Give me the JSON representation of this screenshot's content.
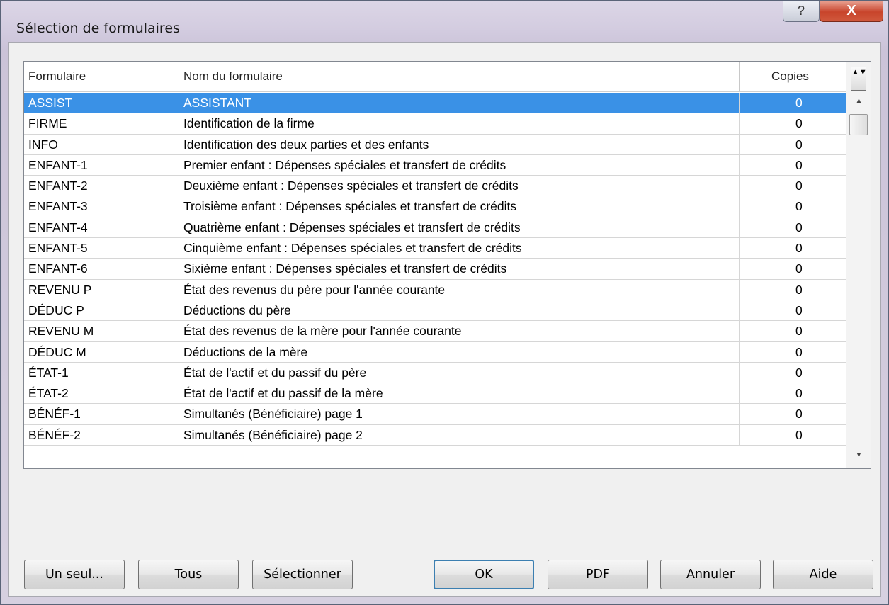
{
  "window": {
    "title": "Sélection de formulaires"
  },
  "titlebar": {
    "help_glyph": "?",
    "close_glyph": "X"
  },
  "grid": {
    "columns": [
      "Formulaire",
      "Nom du formulaire",
      "Copies"
    ],
    "sort_glyph": "▲▼",
    "scroll_up_glyph": "▲",
    "scroll_down_glyph": "▼",
    "rows": [
      {
        "code": "ASSIST",
        "name": "ASSISTANT",
        "copies": "0",
        "selected": true
      },
      {
        "code": "FIRME",
        "name": "Identification de la firme",
        "copies": "0"
      },
      {
        "code": "INFO",
        "name": "Identification des deux parties et des enfants",
        "copies": "0"
      },
      {
        "code": "ENFANT-1",
        "name": "Premier enfant : Dépenses spéciales et transfert de crédits",
        "copies": "0"
      },
      {
        "code": "ENFANT-2",
        "name": "Deuxième enfant : Dépenses spéciales et transfert de crédits",
        "copies": "0"
      },
      {
        "code": "ENFANT-3",
        "name": "Troisième enfant : Dépenses spéciales et transfert de crédits",
        "copies": "0"
      },
      {
        "code": "ENFANT-4",
        "name": "Quatrième enfant : Dépenses spéciales et transfert de crédits",
        "copies": "0"
      },
      {
        "code": "ENFANT-5",
        "name": "Cinquième enfant : Dépenses spéciales et transfert de crédits",
        "copies": "0"
      },
      {
        "code": "ENFANT-6",
        "name": "Sixième enfant : Dépenses spéciales et transfert de crédits",
        "copies": "0"
      },
      {
        "code": "REVENU P",
        "name": "État des revenus du père pour l'année courante",
        "copies": "0"
      },
      {
        "code": "DÉDUC P",
        "name": "Déductions du père",
        "copies": "0"
      },
      {
        "code": "REVENU M",
        "name": "État des revenus de la mère pour l'année courante",
        "copies": "0"
      },
      {
        "code": "DÉDUC M",
        "name": "Déductions de la mère",
        "copies": "0"
      },
      {
        "code": "ÉTAT-1",
        "name": "État de l'actif et du passif du père",
        "copies": "0"
      },
      {
        "code": "ÉTAT-2",
        "name": "État de l'actif et du passif de la mère",
        "copies": "0"
      },
      {
        "code": "BÉNÉF-1",
        "name": "Simultanés (Bénéficiaire) page 1",
        "copies": "0"
      },
      {
        "code": "BÉNÉF-2",
        "name": "Simultanés (Bénéficiaire) page 2",
        "copies": "0"
      }
    ]
  },
  "buttons": {
    "un_seul": "Un seul...",
    "tous": "Tous",
    "selectionner": "Sélectionner",
    "ok": "OK",
    "pdf": "PDF",
    "annuler": "Annuler",
    "aide": "Aide"
  },
  "colors": {
    "selection": "#3a91e6",
    "close_button": "#c8442b"
  }
}
